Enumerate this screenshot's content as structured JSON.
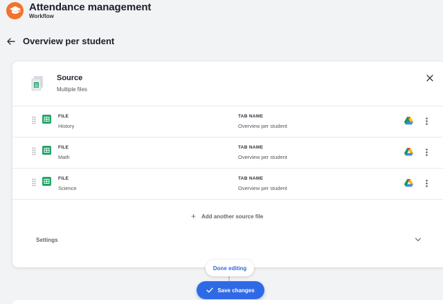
{
  "header": {
    "title": "Attendance management",
    "subtitle": "Workflow",
    "logo_icon": "graduation-cap-icon",
    "accent": "#f2732c"
  },
  "page": {
    "title": "Overview per student",
    "back_icon": "arrow-left-icon"
  },
  "source": {
    "title": "Source",
    "subtitle": "Multiple files",
    "file_label": "FILE",
    "tab_label": "TAB NAME",
    "rows": [
      {
        "file": "History",
        "tab": "Overview per student"
      },
      {
        "file": "Math",
        "tab": "Overview per student"
      },
      {
        "file": "Science",
        "tab": "Overview per student"
      }
    ],
    "add_label": "Add another source file",
    "settings_label": "Settings"
  },
  "actions": {
    "done_label": "Done editing",
    "save_label": "Save changes",
    "primary_color": "#2f6ae6"
  }
}
